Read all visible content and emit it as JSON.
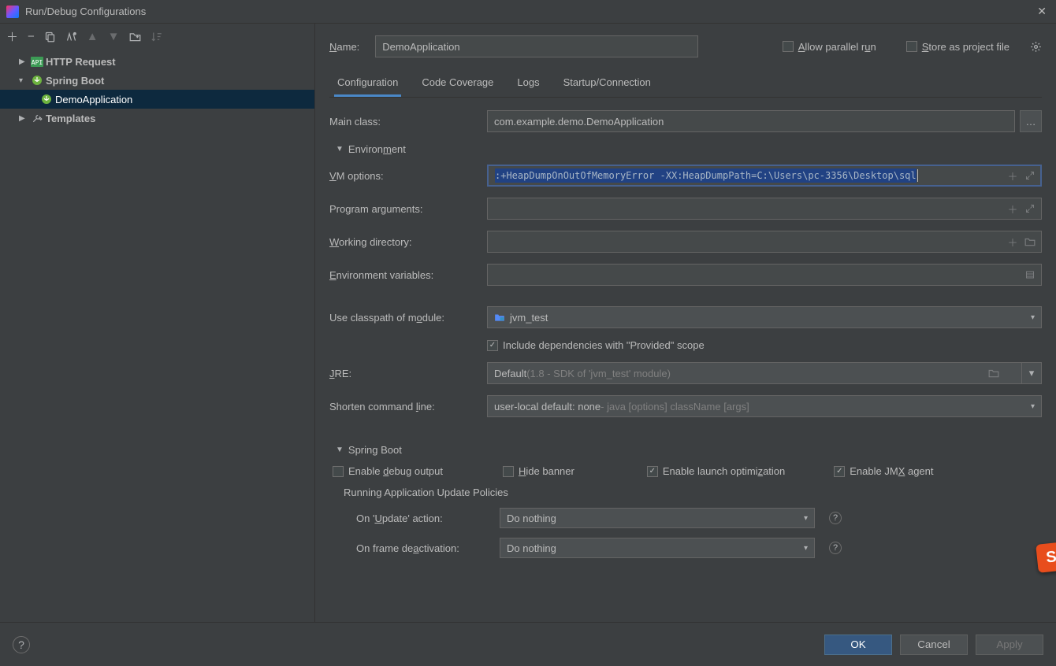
{
  "window": {
    "title": "Run/Debug Configurations"
  },
  "tree": {
    "http_request": "HTTP Request",
    "spring_boot": "Spring Boot",
    "demo_app": "DemoApplication",
    "templates": "Templates"
  },
  "header": {
    "name_label": "Name:",
    "name_value": "DemoApplication",
    "allow_parallel": "Allow parallel run",
    "store_project": "Store as project file"
  },
  "tabs": {
    "config": "Configuration",
    "coverage": "Code Coverage",
    "logs": "Logs",
    "startup": "Startup/Connection"
  },
  "form": {
    "main_class_label": "Main class:",
    "main_class_value": "com.example.demo.DemoApplication",
    "env_section": "Environment",
    "vm_label": "VM options:",
    "vm_value": ":+HeapDumpOnOutOfMemoryError  -XX:HeapDumpPath=C:\\Users\\pc-3356\\Desktop\\sql",
    "prog_args_label": "Program arguments:",
    "work_dir_label": "Working directory:",
    "env_vars_label": "Environment variables:",
    "classpath_label": "Use classpath of module:",
    "classpath_value": "jvm_test",
    "include_provided": "Include dependencies with \"Provided\" scope",
    "jre_label": "JRE:",
    "jre_value": "Default",
    "jre_hint": " (1.8 - SDK of 'jvm_test' module)",
    "shorten_label": "Shorten command line:",
    "shorten_value": "user-local default: none",
    "shorten_hint": " - java [options] className [args]",
    "spring_section": "Spring Boot",
    "enable_debug": "Enable debug output",
    "hide_banner": "Hide banner",
    "enable_launch": "Enable launch optimization",
    "enable_jmx": "Enable JMX agent",
    "update_policies": "Running Application Update Policies",
    "on_update_label": "On 'Update' action:",
    "on_update_value": "Do nothing",
    "on_frame_label": "On frame deactivation:",
    "on_frame_value": "Do nothing"
  },
  "buttons": {
    "ok": "OK",
    "cancel": "Cancel",
    "apply": "Apply"
  }
}
